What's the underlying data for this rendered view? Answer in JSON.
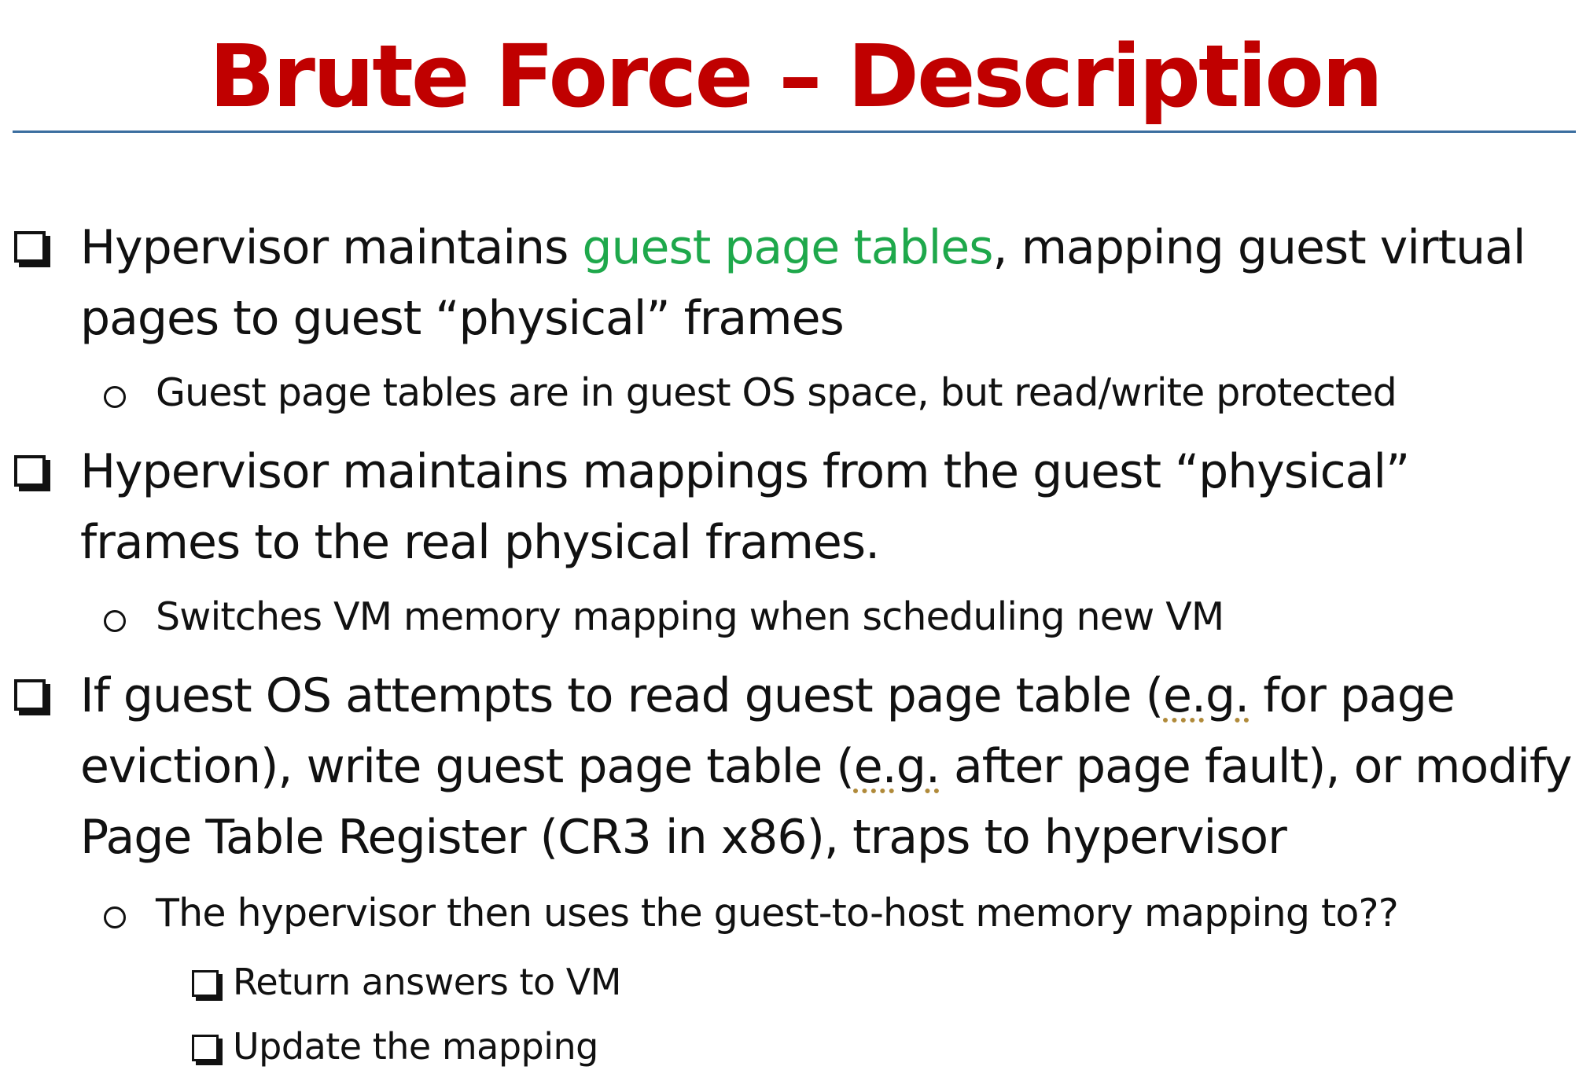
{
  "slide": {
    "title": "Brute Force – Description",
    "title_color": "#c00000",
    "rule_color": "#3b6e9f",
    "highlight_color": "#1ea84b"
  },
  "bullets": [
    {
      "level": 1,
      "prefix": "Hypervisor maintains ",
      "highlight": "guest page tables",
      "suffix": ", mapping guest virtual pages to guest “physical” frames"
    },
    {
      "level": 2,
      "text": "Guest page tables are in guest OS space, but read/write protected"
    },
    {
      "level": 1,
      "text": "Hypervisor maintains mappings from the guest “physical” frames to the real physical frames."
    },
    {
      "level": 2,
      "text": "Switches VM memory mapping when scheduling new VM"
    },
    {
      "level": 1,
      "part1": "If guest OS attempts to read guest page table (",
      "eg1": "e.g.",
      "part2": " for page eviction), write guest page table (",
      "eg2": "e.g.",
      "part3": " after page fault), or modify Page Table Register (CR3 in x86), traps to hypervisor"
    },
    {
      "level": 2,
      "text": "The hypervisor then uses the guest-to-host memory mapping to??"
    },
    {
      "level": 3,
      "text": "Return answers to VM"
    },
    {
      "level": 3,
      "text": "Update the mapping"
    }
  ]
}
